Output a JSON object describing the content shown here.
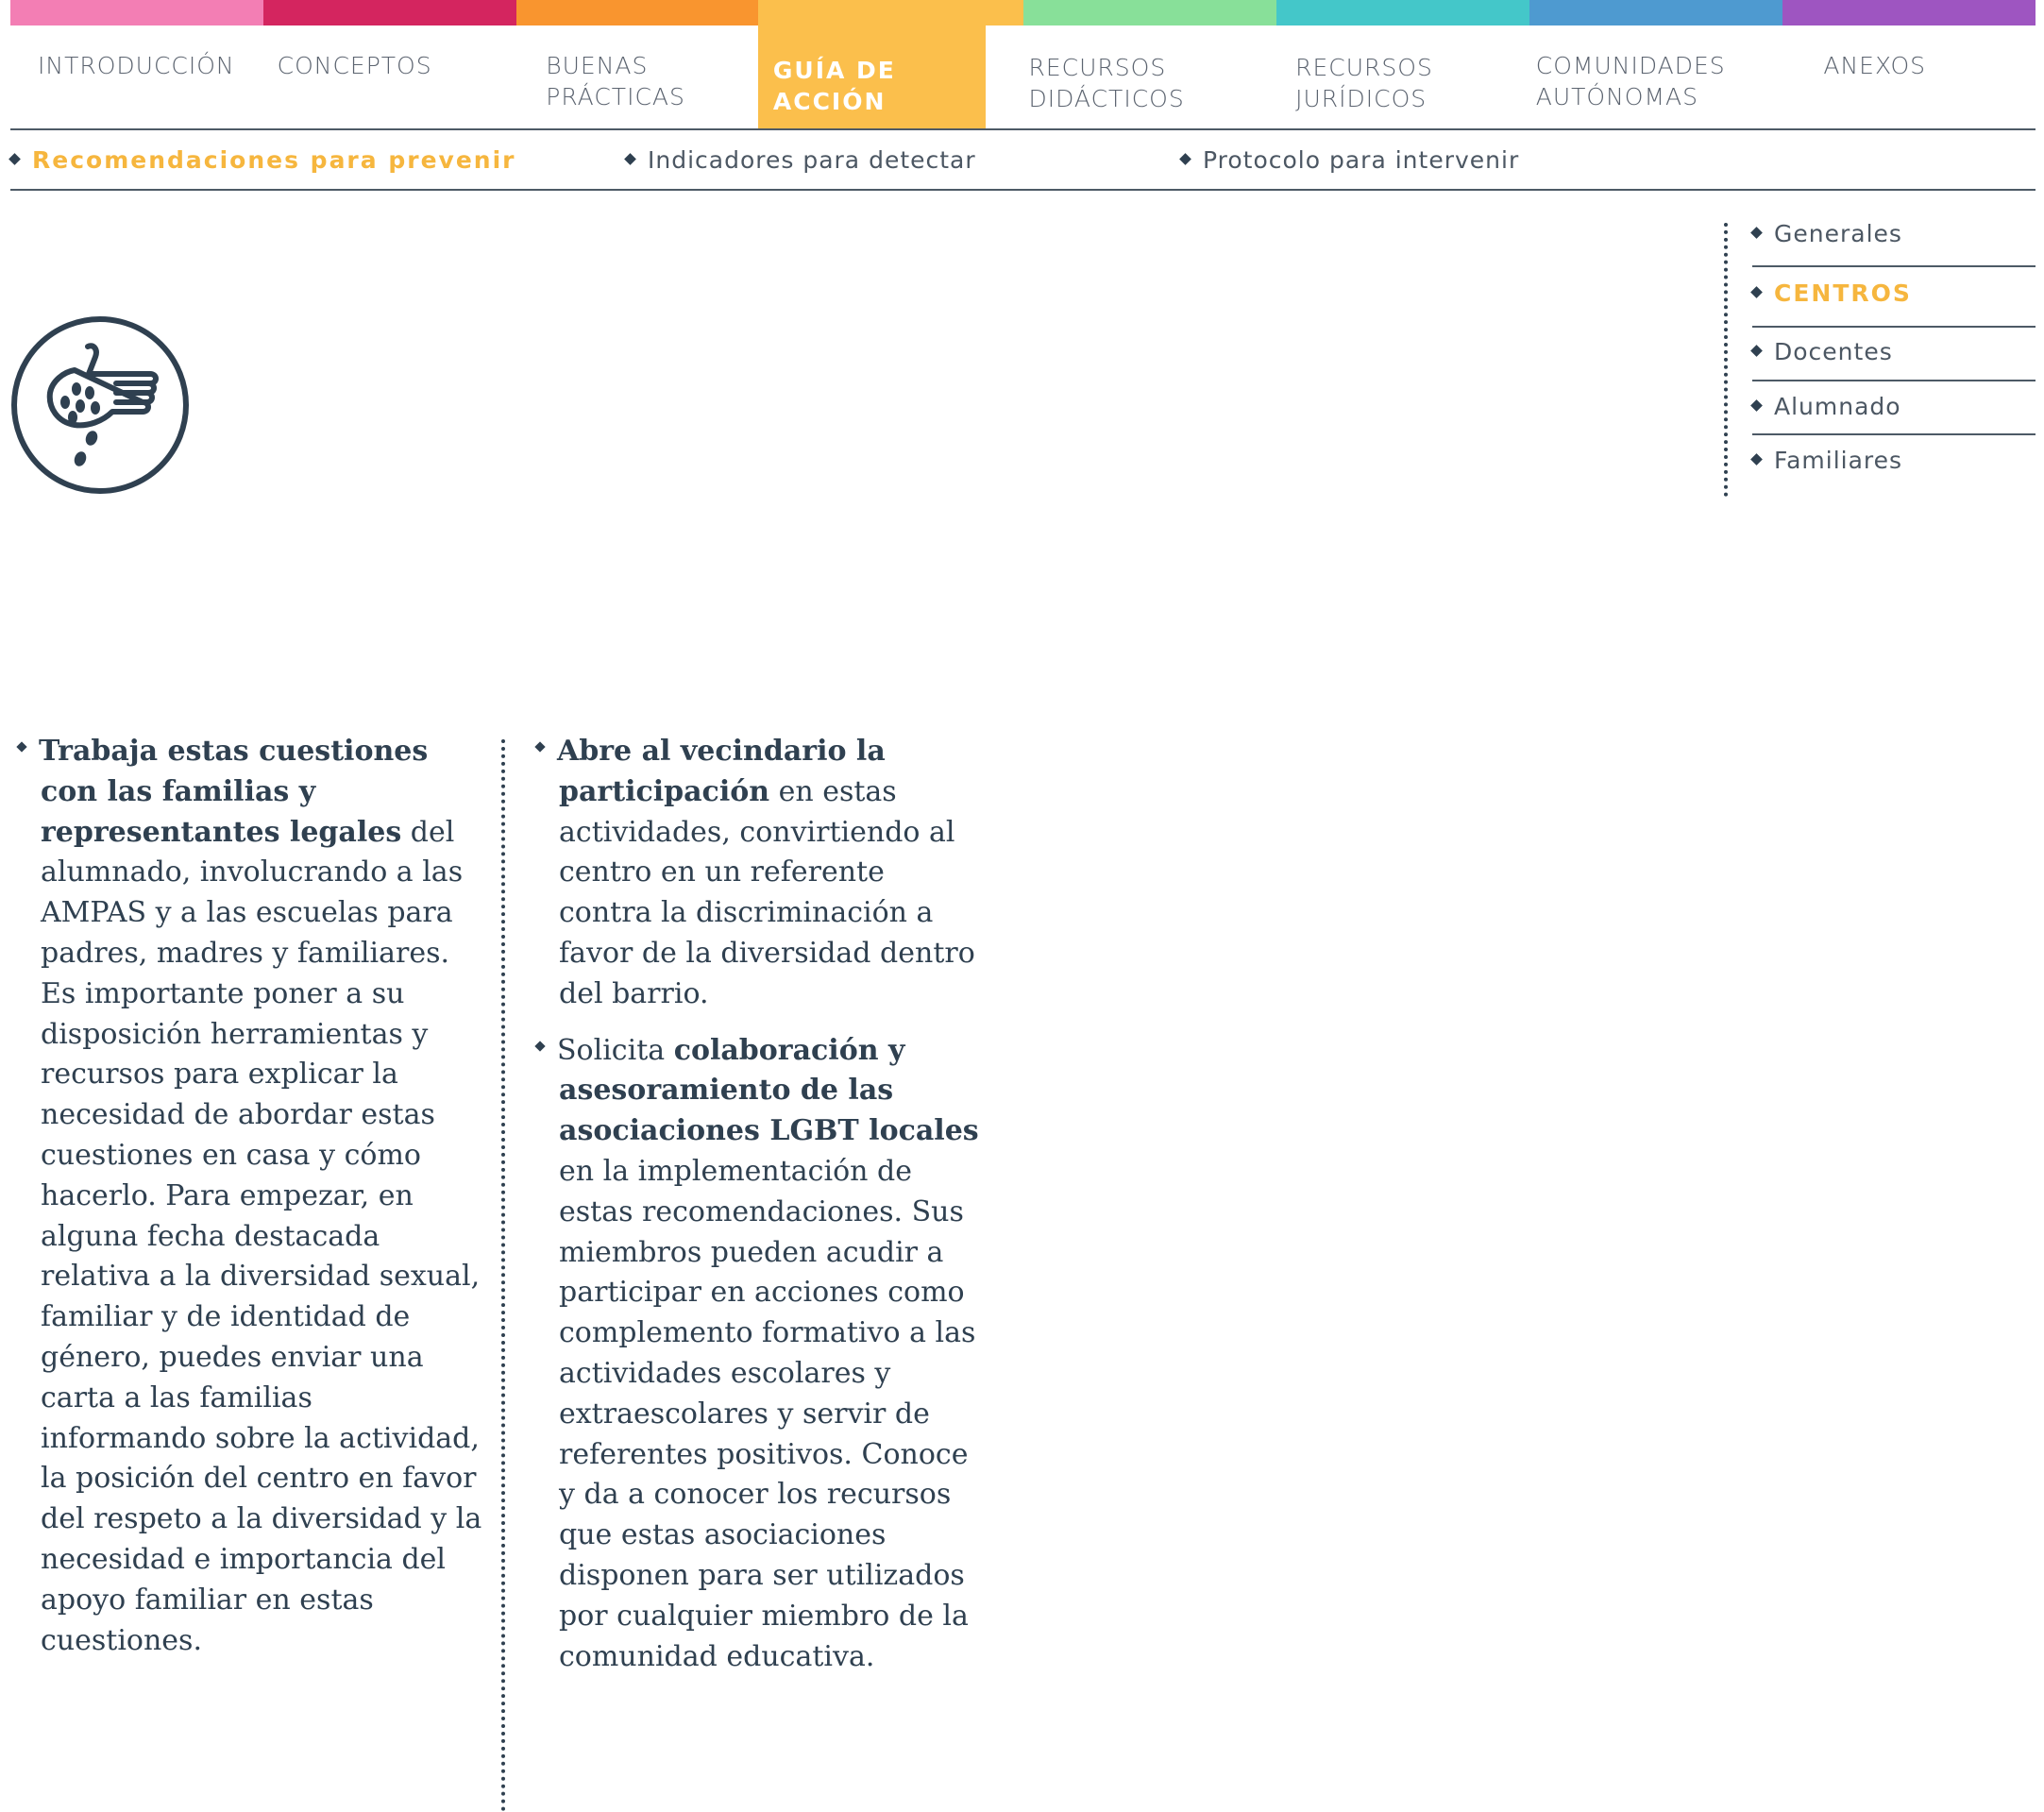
{
  "colors": {
    "bars": [
      "#f37eb4",
      "#d4255f",
      "#f9952f",
      "#fbbf4c",
      "#88e099",
      "#44c7c9",
      "#4e9ad0",
      "#9e55c1"
    ],
    "accent": "#fbbf4c",
    "text": "#2f4050"
  },
  "nav": {
    "items": [
      {
        "lines": [
          "INTRODUCCIÓN"
        ]
      },
      {
        "lines": [
          "CONCEPTOS"
        ]
      },
      {
        "lines": [
          "BUENAS",
          "PRÁCTICAS"
        ]
      },
      {
        "lines": [
          "GUÍA DE ACCIÓN"
        ],
        "active": true
      },
      {
        "lines": [
          "RECURSOS",
          "DIDÁCTICOS"
        ]
      },
      {
        "lines": [
          "RECURSOS",
          "JURÍDICOS"
        ]
      },
      {
        "lines": [
          "COMUNIDADES",
          "AUTÓNOMAS"
        ]
      },
      {
        "lines": [
          "ANEXOS"
        ]
      }
    ]
  },
  "subnav": {
    "items": [
      {
        "label": "Recomendaciones para prevenir",
        "active": true
      },
      {
        "label": "Indicadores para detectar"
      },
      {
        "label": "Protocolo para intervenir"
      }
    ]
  },
  "side_menu": {
    "items": [
      {
        "label": "Generales"
      },
      {
        "label": "CENTROS",
        "active": true
      },
      {
        "label": "Docentes"
      },
      {
        "label": "Alumnado"
      },
      {
        "label": "Familiares"
      }
    ]
  },
  "icon": {
    "name": "hand-seeds-icon"
  },
  "content": {
    "col1": {
      "p1": {
        "bold": "Trabaja estas cuestiones con las familias y representantes legales",
        "text": " del alumnado, involucrando a las AMPAS y a las escuelas para padres, madres y familiares. Es importante poner a su disposición herramientas y recursos para explicar la necesidad de abordar estas cuestiones en casa y cómo hacerlo. Para empezar, en alguna fecha destacada relativa a la diversidad sexual, familiar y de identidad de género, puedes enviar una carta a las familias informando sobre la actividad, la posición del centro en favor del respeto a la diversidad y la necesidad e importancia del apoyo familiar en estas cuestiones."
      }
    },
    "col2": {
      "p1": {
        "bold": "Abre al vecindario la participación",
        "text": " en estas actividades, convirtiendo al centro en un referente contra la discriminación a favor de la diversidad dentro del barrio."
      },
      "p2": {
        "pre": "Solicita ",
        "bold": "colaboración y asesoramiento de las asociaciones LGBT locales",
        "text": " en la implementación de estas recomendaciones. Sus miembros pueden acudir a participar en acciones como complemento formativo a las actividades escolares y extraescolares y servir de referentes positivos. Conoce y da a conocer los recursos que estas asociaciones disponen para ser utilizados por cualquier miembro de la comunidad educativa."
      }
    }
  }
}
